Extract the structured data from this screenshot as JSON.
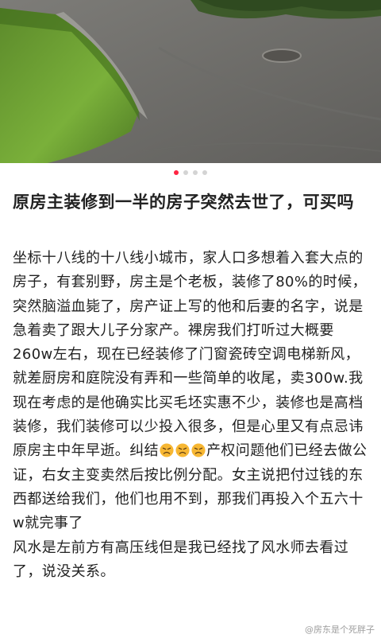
{
  "post": {
    "title": "原房主装修到一半的房子突然去世了，可买吗",
    "body_before_emoji": "坐标十八线的十八线小城市，家人口多想着入套大点的房子，有套别野，房主是个老板，装修了80%的时候，突然脑溢血毙了，房产证上写的他和后妻的名字，说是急着卖了跟大儿子分家产。裸房我们打听过大概要260w左右，现在已经装修了门窗瓷砖空调电梯新风，就差厨房和庭院没有弄和一些简单的收尾，卖300w.我现在考虑的是他确实比买毛坯实惠不少，装修也是高档装修，我们装修可以少投入很多，但是心里又有点忌讳原房主中年早逝。纠结",
    "body_after_emoji": "产权问题他们已经去做公证，右女主变卖然后按比例分配。女主说把付过钱的东西都送给我们，他们也用不到，那我们再投入个五六十w就完事了",
    "body_p2": "风水是左前方有高压线但是我已经找了风水师去看过了，说没关系。",
    "emoji_icons": [
      "persevere-face-icon",
      "persevere-face-icon",
      "persevere-face-icon"
    ]
  },
  "carousel": {
    "total": 4,
    "active": 1
  },
  "watermark": "@房东是个死胖子"
}
